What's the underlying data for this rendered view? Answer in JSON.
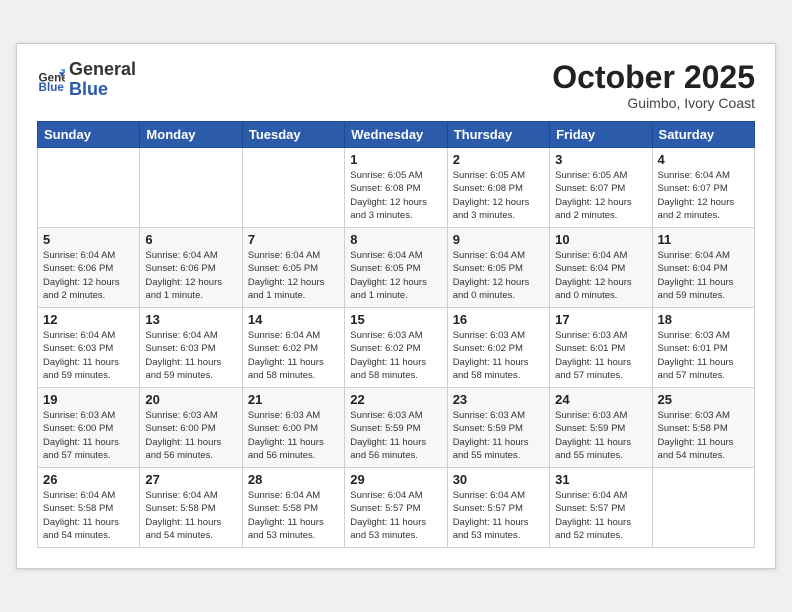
{
  "header": {
    "logo_line1": "General",
    "logo_line2": "Blue",
    "month": "October 2025",
    "location": "Guimbo, Ivory Coast"
  },
  "weekdays": [
    "Sunday",
    "Monday",
    "Tuesday",
    "Wednesday",
    "Thursday",
    "Friday",
    "Saturday"
  ],
  "weeks": [
    [
      {
        "day": "",
        "info": ""
      },
      {
        "day": "",
        "info": ""
      },
      {
        "day": "",
        "info": ""
      },
      {
        "day": "1",
        "info": "Sunrise: 6:05 AM\nSunset: 6:08 PM\nDaylight: 12 hours\nand 3 minutes."
      },
      {
        "day": "2",
        "info": "Sunrise: 6:05 AM\nSunset: 6:08 PM\nDaylight: 12 hours\nand 3 minutes."
      },
      {
        "day": "3",
        "info": "Sunrise: 6:05 AM\nSunset: 6:07 PM\nDaylight: 12 hours\nand 2 minutes."
      },
      {
        "day": "4",
        "info": "Sunrise: 6:04 AM\nSunset: 6:07 PM\nDaylight: 12 hours\nand 2 minutes."
      }
    ],
    [
      {
        "day": "5",
        "info": "Sunrise: 6:04 AM\nSunset: 6:06 PM\nDaylight: 12 hours\nand 2 minutes."
      },
      {
        "day": "6",
        "info": "Sunrise: 6:04 AM\nSunset: 6:06 PM\nDaylight: 12 hours\nand 1 minute."
      },
      {
        "day": "7",
        "info": "Sunrise: 6:04 AM\nSunset: 6:05 PM\nDaylight: 12 hours\nand 1 minute."
      },
      {
        "day": "8",
        "info": "Sunrise: 6:04 AM\nSunset: 6:05 PM\nDaylight: 12 hours\nand 1 minute."
      },
      {
        "day": "9",
        "info": "Sunrise: 6:04 AM\nSunset: 6:05 PM\nDaylight: 12 hours\nand 0 minutes."
      },
      {
        "day": "10",
        "info": "Sunrise: 6:04 AM\nSunset: 6:04 PM\nDaylight: 12 hours\nand 0 minutes."
      },
      {
        "day": "11",
        "info": "Sunrise: 6:04 AM\nSunset: 6:04 PM\nDaylight: 11 hours\nand 59 minutes."
      }
    ],
    [
      {
        "day": "12",
        "info": "Sunrise: 6:04 AM\nSunset: 6:03 PM\nDaylight: 11 hours\nand 59 minutes."
      },
      {
        "day": "13",
        "info": "Sunrise: 6:04 AM\nSunset: 6:03 PM\nDaylight: 11 hours\nand 59 minutes."
      },
      {
        "day": "14",
        "info": "Sunrise: 6:04 AM\nSunset: 6:02 PM\nDaylight: 11 hours\nand 58 minutes."
      },
      {
        "day": "15",
        "info": "Sunrise: 6:03 AM\nSunset: 6:02 PM\nDaylight: 11 hours\nand 58 minutes."
      },
      {
        "day": "16",
        "info": "Sunrise: 6:03 AM\nSunset: 6:02 PM\nDaylight: 11 hours\nand 58 minutes."
      },
      {
        "day": "17",
        "info": "Sunrise: 6:03 AM\nSunset: 6:01 PM\nDaylight: 11 hours\nand 57 minutes."
      },
      {
        "day": "18",
        "info": "Sunrise: 6:03 AM\nSunset: 6:01 PM\nDaylight: 11 hours\nand 57 minutes."
      }
    ],
    [
      {
        "day": "19",
        "info": "Sunrise: 6:03 AM\nSunset: 6:00 PM\nDaylight: 11 hours\nand 57 minutes."
      },
      {
        "day": "20",
        "info": "Sunrise: 6:03 AM\nSunset: 6:00 PM\nDaylight: 11 hours\nand 56 minutes."
      },
      {
        "day": "21",
        "info": "Sunrise: 6:03 AM\nSunset: 6:00 PM\nDaylight: 11 hours\nand 56 minutes."
      },
      {
        "day": "22",
        "info": "Sunrise: 6:03 AM\nSunset: 5:59 PM\nDaylight: 11 hours\nand 56 minutes."
      },
      {
        "day": "23",
        "info": "Sunrise: 6:03 AM\nSunset: 5:59 PM\nDaylight: 11 hours\nand 55 minutes."
      },
      {
        "day": "24",
        "info": "Sunrise: 6:03 AM\nSunset: 5:59 PM\nDaylight: 11 hours\nand 55 minutes."
      },
      {
        "day": "25",
        "info": "Sunrise: 6:03 AM\nSunset: 5:58 PM\nDaylight: 11 hours\nand 54 minutes."
      }
    ],
    [
      {
        "day": "26",
        "info": "Sunrise: 6:04 AM\nSunset: 5:58 PM\nDaylight: 11 hours\nand 54 minutes."
      },
      {
        "day": "27",
        "info": "Sunrise: 6:04 AM\nSunset: 5:58 PM\nDaylight: 11 hours\nand 54 minutes."
      },
      {
        "day": "28",
        "info": "Sunrise: 6:04 AM\nSunset: 5:58 PM\nDaylight: 11 hours\nand 53 minutes."
      },
      {
        "day": "29",
        "info": "Sunrise: 6:04 AM\nSunset: 5:57 PM\nDaylight: 11 hours\nand 53 minutes."
      },
      {
        "day": "30",
        "info": "Sunrise: 6:04 AM\nSunset: 5:57 PM\nDaylight: 11 hours\nand 53 minutes."
      },
      {
        "day": "31",
        "info": "Sunrise: 6:04 AM\nSunset: 5:57 PM\nDaylight: 11 hours\nand 52 minutes."
      },
      {
        "day": "",
        "info": ""
      }
    ]
  ]
}
